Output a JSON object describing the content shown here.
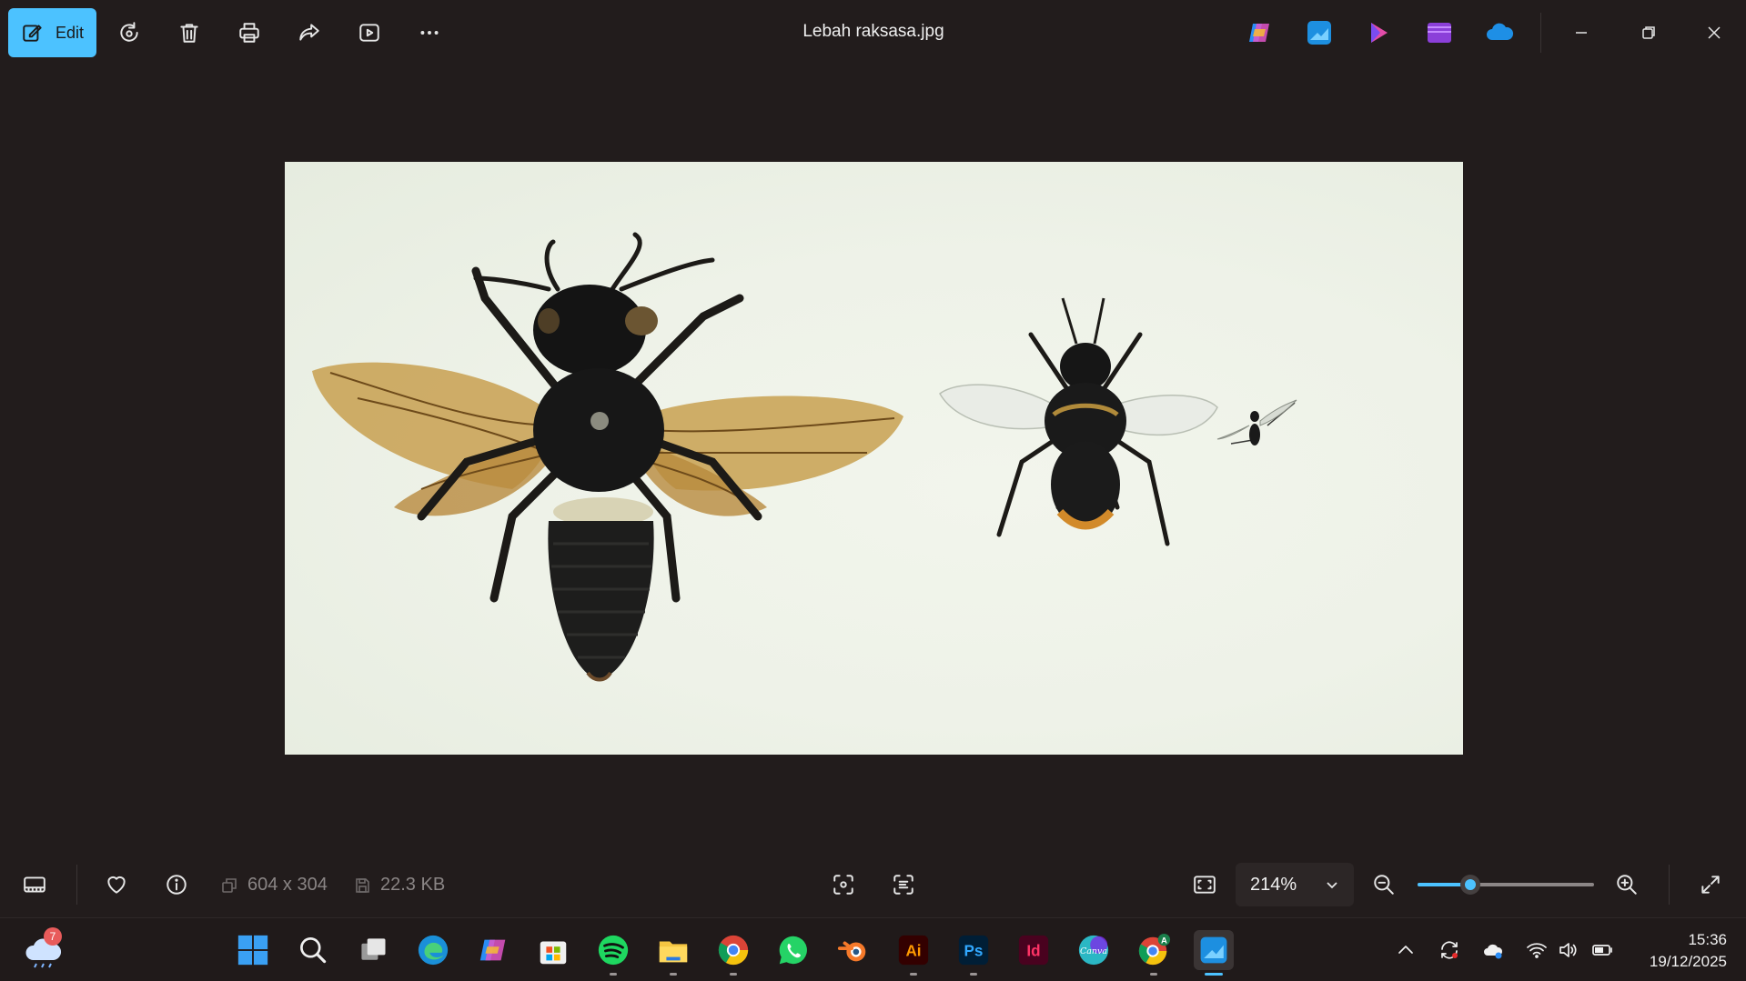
{
  "toolbar": {
    "edit_label": "Edit",
    "title": "Lebah raksasa.jpg",
    "icons": [
      "edit-icon",
      "rotate-icon",
      "delete-icon",
      "print-icon",
      "share-icon",
      "slideshow-icon",
      "more-icon"
    ],
    "app_icons": [
      "copilot",
      "photos",
      "clipchamp",
      "designer",
      "onedrive"
    ],
    "window_controls": [
      "minimize",
      "restore",
      "close"
    ]
  },
  "bottombar": {
    "dimensions": "604 x 304",
    "file_size": "22.3 KB",
    "zoom_value": "214%",
    "zoom_level": 0.3
  },
  "taskbar": {
    "weather_badge": "7",
    "apps": [
      "start",
      "search",
      "task-view",
      "edge",
      "copilot",
      "store",
      "spotify",
      "file-explorer",
      "chrome",
      "whatsapp",
      "blender",
      "illustrator",
      "photoshop",
      "indesign",
      "canva",
      "chrome-profile",
      "photos"
    ],
    "labels": {
      "illustrator": "Ai",
      "photoshop": "Ps",
      "indesign": "Id",
      "canva": "Canva",
      "chrome_profile_badge": "A"
    },
    "time": "15:36",
    "date": "19/12/2025"
  },
  "colors": {
    "accent": "#4cc2ff",
    "background": "#221c1c",
    "taskbar": "#201a1a"
  }
}
